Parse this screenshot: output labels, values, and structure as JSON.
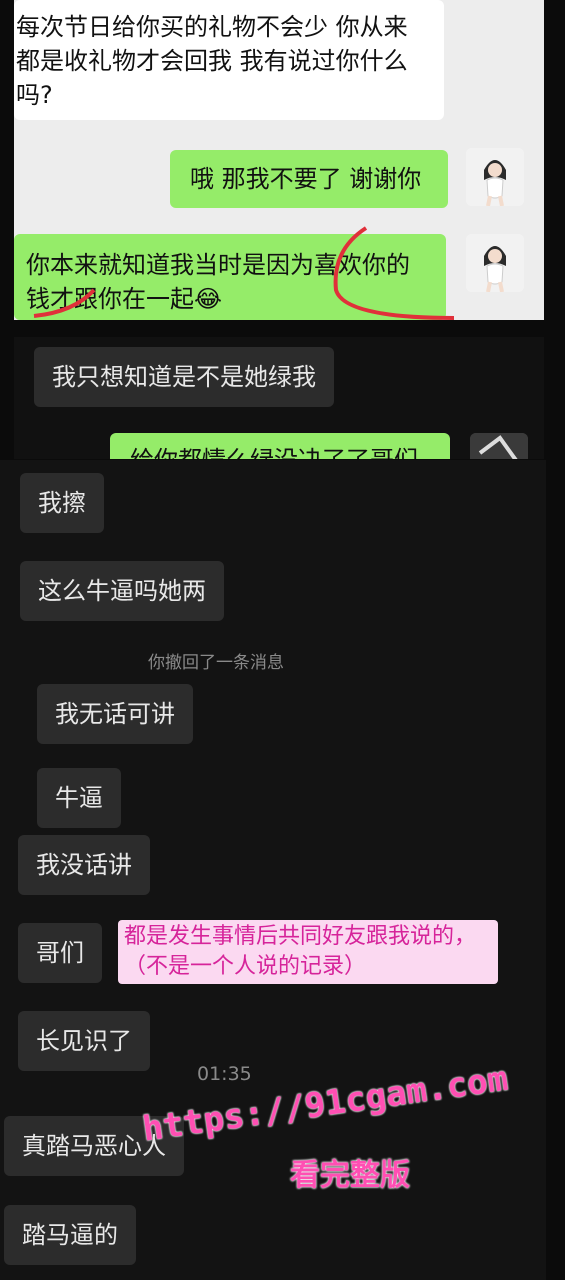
{
  "chat_top": {
    "msg1": "每次节日给你买的礼物不会少 你从来\n都是收礼物才会回我 我有说过你什么\n吗?",
    "msg2": "哦 那我不要了 谢谢你",
    "msg3": "你本来就知道我当时是因为喜欢你的\n钱才跟你在一起😂"
  },
  "chat_mid": {
    "msg1": "我只想知道是不是她绿我",
    "msg2_partial": "给你都情么绿没决了了哥们"
  },
  "chat_bottom": {
    "msg1": "我擦",
    "msg2": "这么牛逼吗她两",
    "recall_notice": "你撤回了一条消息",
    "msg3": "我无话可讲",
    "msg4": "牛逼",
    "msg5": "我没话讲",
    "msg6": "哥们",
    "msg7": "长见识了",
    "timestamp": "01:35",
    "msg8": "真踏马恶心人",
    "msg9": "踏马逼的"
  },
  "annotation": "都是发生事情后共同好友跟我说的，（不是一个人说的记录）",
  "watermark": {
    "url": "https://91cgam.com",
    "caption": "看完整版"
  },
  "colors": {
    "green_bubble": "#95ec69",
    "dark_bubble": "#2c2c2c",
    "annotation_text": "#d6249a",
    "watermark": "#ff4fb3"
  }
}
